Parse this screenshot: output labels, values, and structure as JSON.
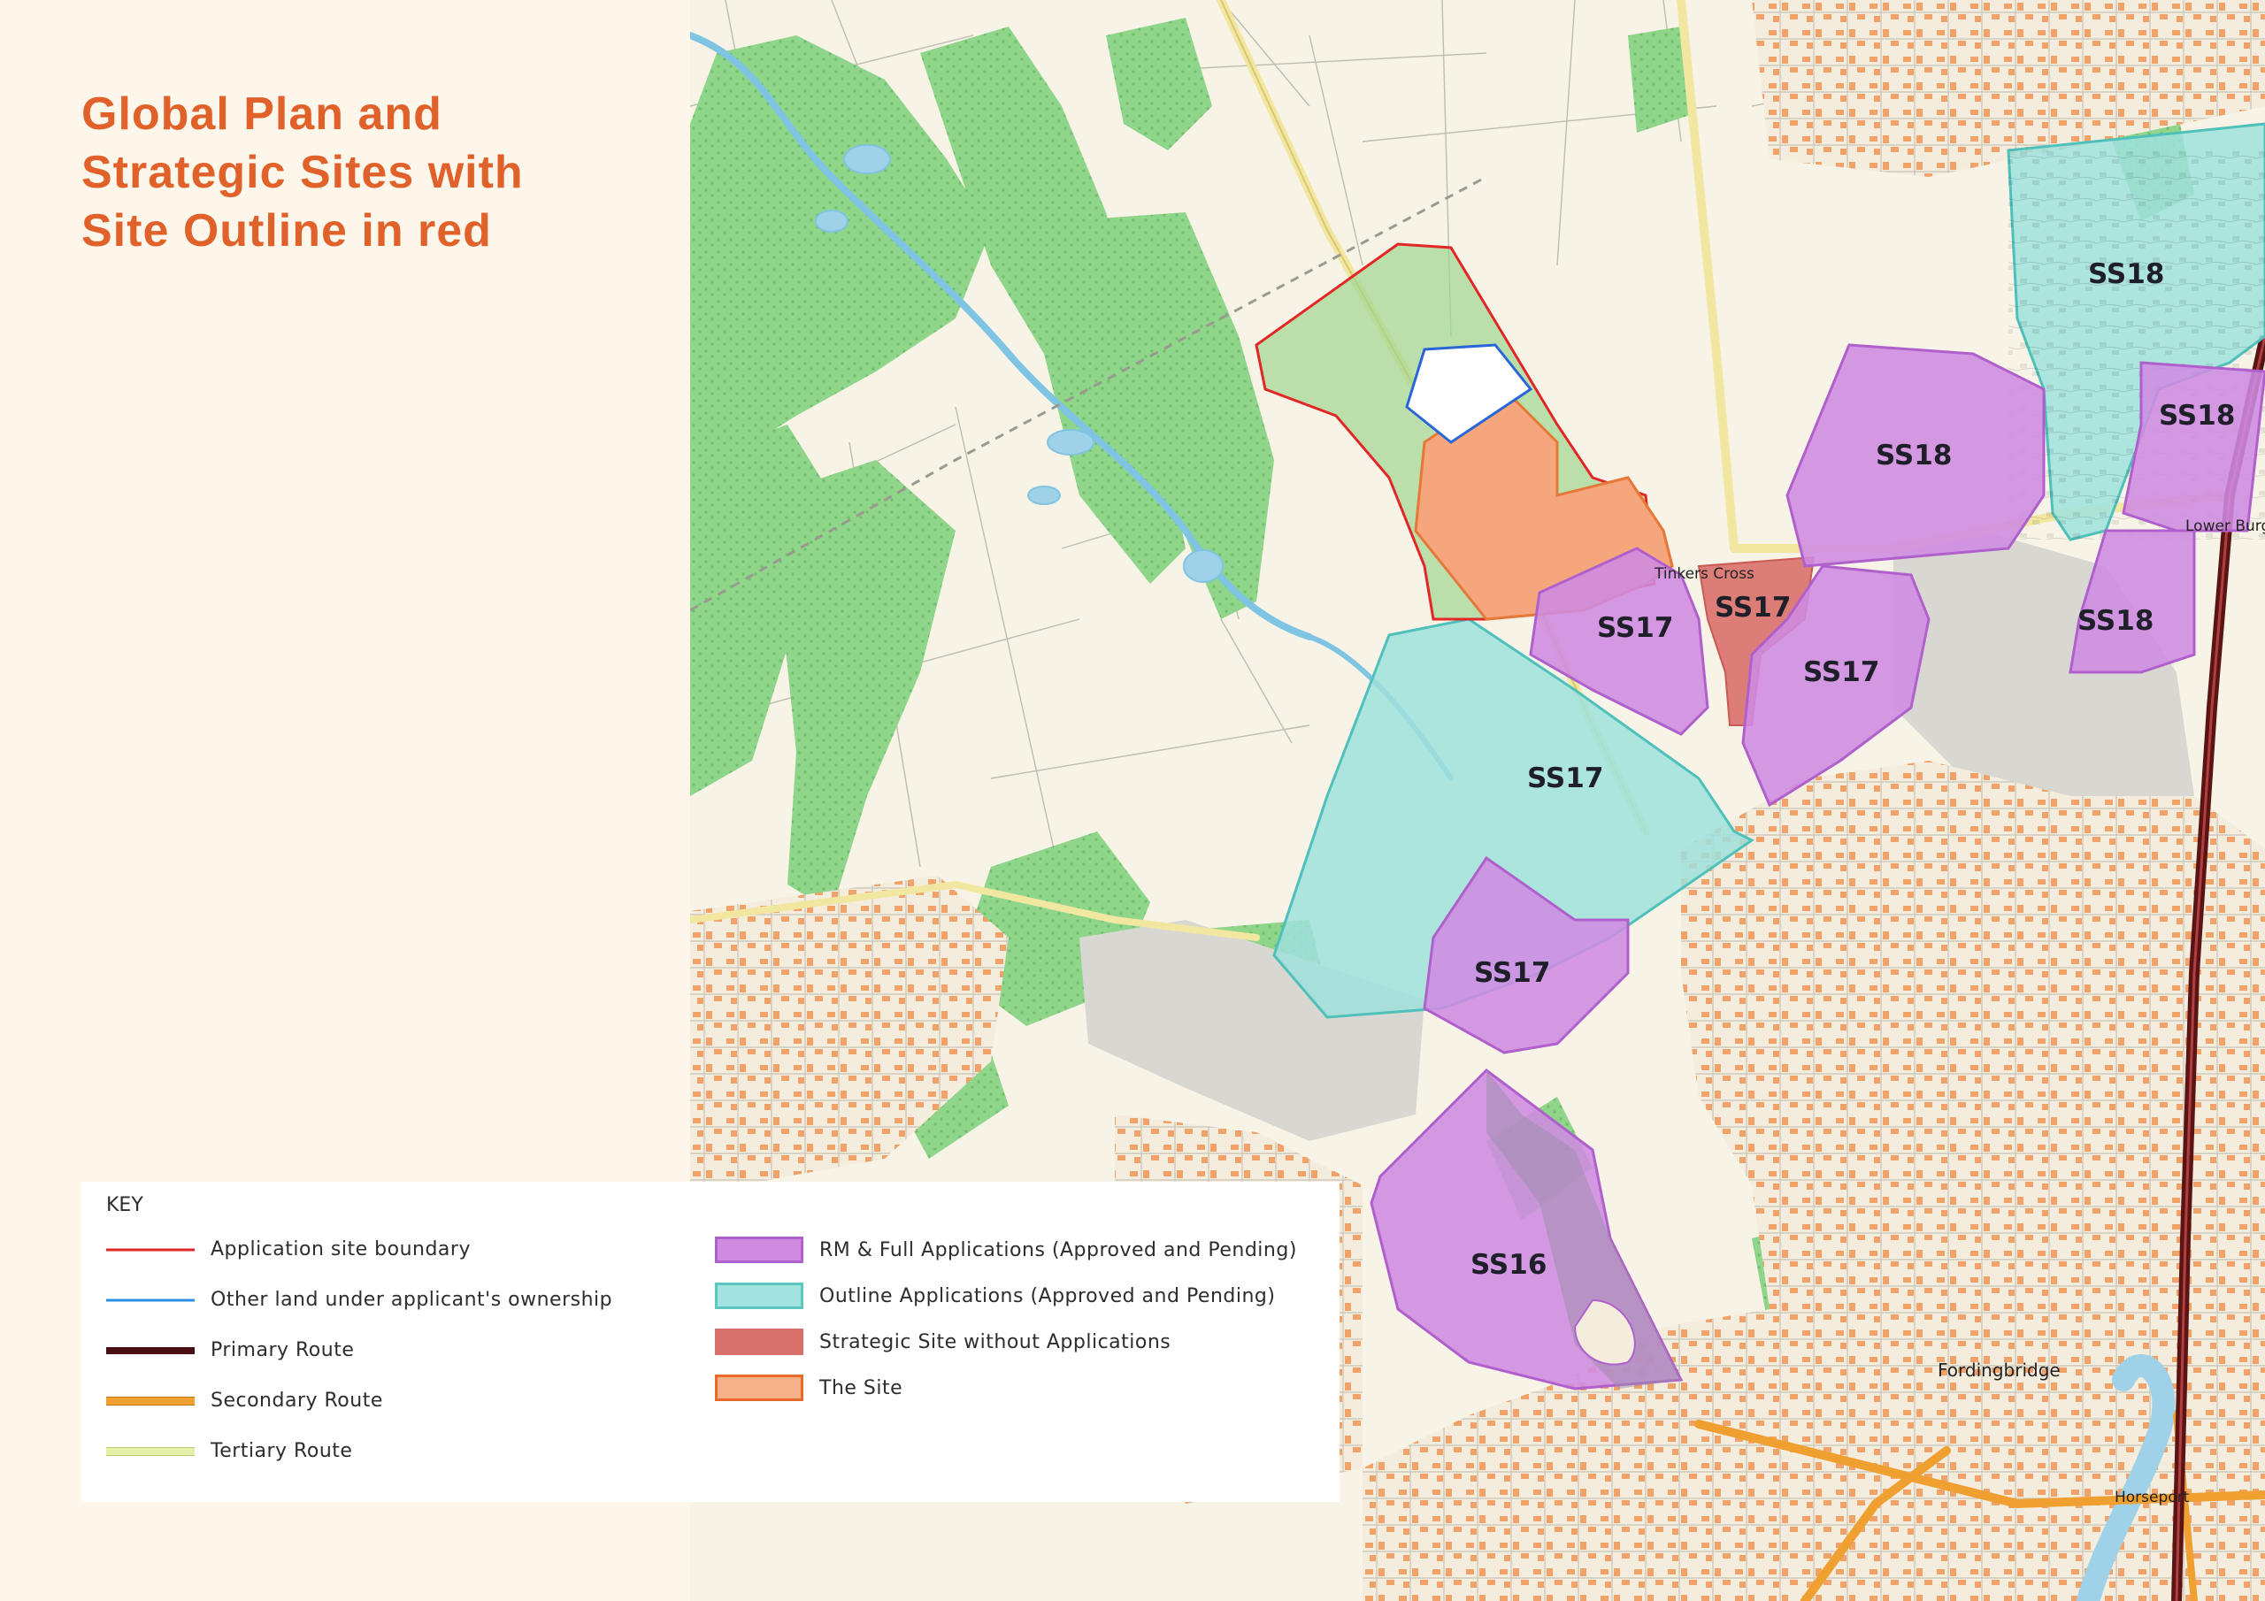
{
  "title": {
    "lines": [
      "Global Plan and",
      "Strategic Sites with",
      "Site Outline in red"
    ],
    "color": "#e0612a"
  },
  "map": {
    "site_labels": [
      "SS18",
      "SS18",
      "SS18",
      "SS18",
      "SS17",
      "SS17",
      "SS17",
      "SS17",
      "SS17",
      "SS16"
    ],
    "place_names": {
      "tinkers_cross": "Tinkers Cross",
      "lower_burgate": "Lower Burgate",
      "fordingbridge": "Fordingbridge",
      "horseport": "Horseport"
    },
    "colors": {
      "base": "#f7f3e6",
      "woodland": "#8fd58a",
      "water": "#9fd2e8",
      "built_grey": "#d9d7d2",
      "building": "#f0a268",
      "application_boundary": "#e32626",
      "applicant_land": "#2b66d8",
      "rm_full": "#cf8be3",
      "outline": "#9fe0dc",
      "strategic_no_app": "#d9706a",
      "the_site": "#f5a97a",
      "primary_route": "#5a1414",
      "secondary_route": "#f0a030"
    }
  },
  "key": {
    "title": "KEY",
    "items_left": [
      {
        "label": "Application site boundary",
        "color": "#e32626",
        "style": "line"
      },
      {
        "label": "Other land under applicant's ownership",
        "color": "#2b8de0",
        "style": "line"
      },
      {
        "label": "Primary Route",
        "color": "#4a0f14",
        "style": "thick"
      },
      {
        "label": "Secondary Route",
        "color": "#f0a030",
        "style": "double"
      },
      {
        "label": "Tertiary Route",
        "color": "#d8e890",
        "style": "double"
      }
    ],
    "items_right": [
      {
        "label": "RM & Full Applications (Approved and Pending)",
        "fill": "#d08be0",
        "stroke": "#b060cc"
      },
      {
        "label": "Outline Applications (Approved and Pending)",
        "fill": "#a3e3df",
        "stroke": "#5cc6c0"
      },
      {
        "label": "Strategic Site without Applications",
        "fill": "#d8706c",
        "stroke": "#d8706c"
      },
      {
        "label": "The Site",
        "fill": "#f6b08a",
        "stroke": "#e86a2a"
      }
    ]
  }
}
